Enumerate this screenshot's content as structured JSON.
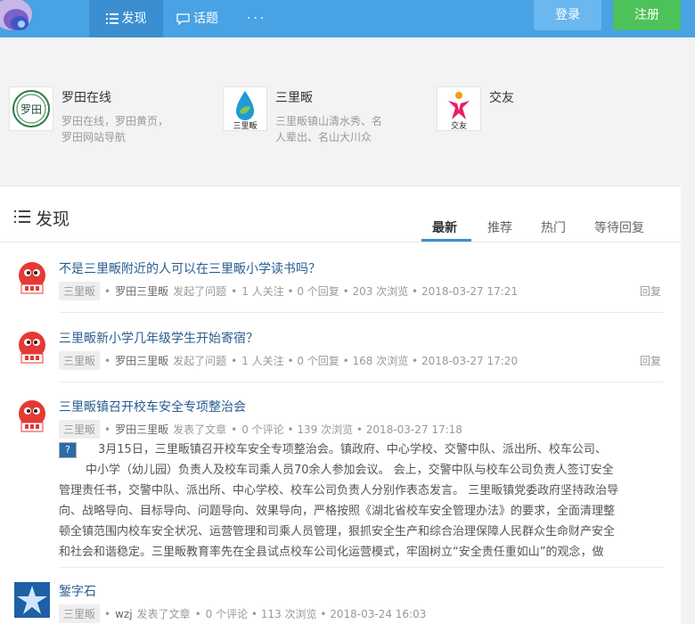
{
  "nav": {
    "discover": "发现",
    "topics": "话题",
    "more": "···",
    "login": "登录",
    "register": "注册"
  },
  "sites": [
    {
      "name": "罗田在线",
      "desc_line1": "罗田在线，罗田黄页，",
      "desc_line2": "罗田网站导航",
      "logo_text": "罗田"
    },
    {
      "name": "三里畈",
      "desc_line1": "三里畈镇山清水秀、名",
      "desc_line2": "人辈出、名山大川众",
      "logo_text": "三里畈"
    },
    {
      "name": "交友",
      "desc_line1": "",
      "desc_line2": "",
      "logo_text": "交友"
    }
  ],
  "feed": {
    "title": "发现",
    "tabs": [
      "最新",
      "推荐",
      "热门",
      "等待回复"
    ],
    "items": [
      {
        "title": "不是三里畈附近的人可以在三里畈小学读书吗？",
        "tag": "三里畈",
        "author": "罗田三里畈",
        "action": "发起了问题",
        "stats": "1 人关注 • 0 个回复 • 203 次浏览 • 2018-03-27 17:21",
        "reply": "回复"
      },
      {
        "title": "三里畈新小学几年级学生开始寄宿？",
        "tag": "三里畈",
        "author": "罗田三里畈",
        "action": "发起了问题",
        "stats": "1 人关注 • 0 个回复 • 168 次浏览 • 2018-03-27 17:20",
        "reply": "回复"
      },
      {
        "title": "三里畈镇召开校车安全专项整治会",
        "tag": "三里畈",
        "author": "罗田三里畈",
        "action": "发表了文章",
        "stats": "0 个评论 • 139 次浏览 • 2018-03-27 17:18",
        "reply": ""
      },
      {
        "title": "錾字石",
        "tag": "三里畈",
        "author": "wzj",
        "action": "发表了文章",
        "stats": "0 个评论 • 113 次浏览 • 2018-03-24 16:03",
        "reply": ""
      }
    ],
    "article_summary": {
      "line1": "3月15日，三里畈镇召开校车安全专项整治会。镇政府、中心学校、交警中队、派出所、校车公司、",
      "line2": "中小学（幼儿园）负责人及校车司乘人员70余人参加会议。 会上，交警中队与校车公司负责人签订安全",
      "line3": "管理责任书，交警中队、派出所、中心学校、校车公司负责人分别作表态发言。 三里畈镇党委政府坚持政治导",
      "line4": "向、战略导向、目标导向、问题导向、效果导向，严格按照《湖北省校车安全管理办法》的要求，全面清理整",
      "line5": "顿全镇范围内校车安全状况、运营管理和司乘人员管理，狠抓安全生产和综合治理保障人民群众生命财产安全",
      "line6": "和社会和谐稳定。三里畈教育率先在全县试点校车公司化运营模式，牢固树立“安全责任重如山”的观念，做"
    }
  },
  "colors": {
    "topbar": "#48a2e3",
    "nav_active": "#3b8fd0",
    "login": "#6bb7ef",
    "register": "#4ec25a",
    "link": "#2a5d8f"
  }
}
